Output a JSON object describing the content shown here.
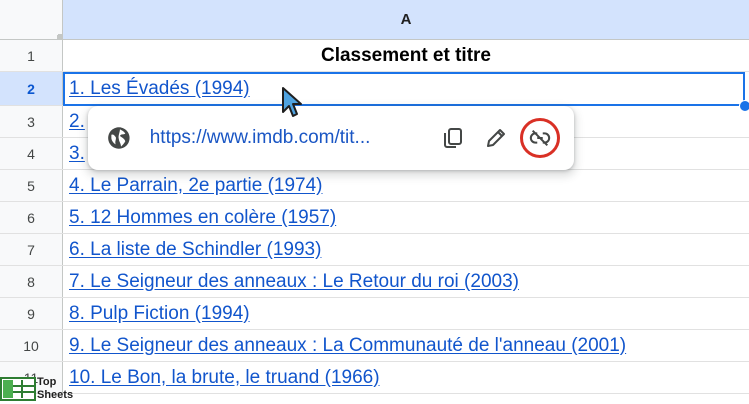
{
  "column_header": "A",
  "header_row": {
    "number": "1",
    "text": "Classement et titre"
  },
  "rows": [
    {
      "number": "2",
      "text": "1. Les Évadés (1994)"
    },
    {
      "number": "3",
      "text": "2."
    },
    {
      "number": "4",
      "text": "3."
    },
    {
      "number": "5",
      "text": "4. Le Parrain, 2e partie (1974)"
    },
    {
      "number": "6",
      "text": "5. 12 Hommes en colère (1957)"
    },
    {
      "number": "7",
      "text": "6. La liste de Schindler (1993)"
    },
    {
      "number": "8",
      "text": "7. Le Seigneur des anneaux : Le Retour du roi (2003)"
    },
    {
      "number": "9",
      "text": "8. Pulp Fiction (1994)"
    },
    {
      "number": "10",
      "text": "9. Le Seigneur des anneaux : La Communauté de l'anneau (2001)"
    },
    {
      "number": "11",
      "text": "10. Le Bon, la brute, le truand (1966)"
    }
  ],
  "link_popup": {
    "url": "https://www.imdb.com/tit...",
    "icons": [
      "globe-icon",
      "copy-icon",
      "edit-icon",
      "unlink-icon"
    ],
    "highlight_color": "#d93025"
  },
  "watermark": {
    "line1": "Top",
    "line2": "Sheets"
  },
  "colors": {
    "link": "#1155cc",
    "selection": "#1a73e8",
    "header_bg": "#d3e3fd"
  }
}
